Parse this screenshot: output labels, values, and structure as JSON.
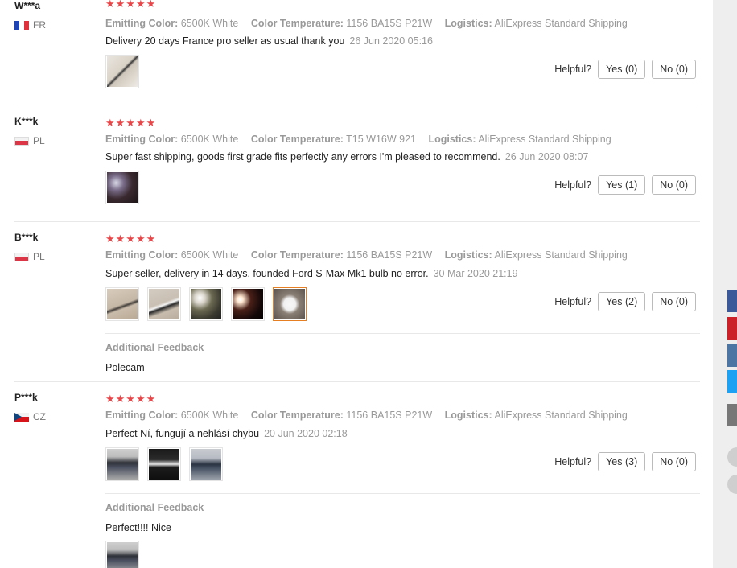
{
  "colors": {
    "star": "#e8474a",
    "accent_border": "#e67e22"
  },
  "helpful_label": "Helpful?",
  "attr_keys": {
    "color": "Emitting Color:",
    "temp": "Color Temperature:",
    "logistics": "Logistics:"
  },
  "additional_feedback_title": "Additional Feedback",
  "reviews": [
    {
      "user": "W***a",
      "country": "FR",
      "stars": "★★★★★",
      "color": "6500K White",
      "temp": "1156 BA15S P21W",
      "logistics": "AliExpress Standard Shipping",
      "text": "Delivery 20 days France pro seller as usual thank you",
      "date": "26 Jun 2020 05:16",
      "yes": "Yes (0)",
      "no": "No (0)"
    },
    {
      "user": "K***k",
      "country": "PL",
      "stars": "★★★★★",
      "color": "6500K White",
      "temp": "T15 W16W 921",
      "logistics": "AliExpress Standard Shipping",
      "text": "Super fast shipping, goods first grade fits perfectly any errors I'm pleased to recommend.",
      "date": "26 Jun 2020 08:07",
      "yes": "Yes (1)",
      "no": "No (0)"
    },
    {
      "user": "B***k",
      "country": "PL",
      "stars": "★★★★★",
      "color": "6500K White",
      "temp": "1156 BA15S P21W",
      "logistics": "AliExpress Standard Shipping",
      "text": "Super seller, delivery in 14 days, founded Ford S-Max Mk1 bulb no error.",
      "date": "30 Mar 2020 21:19",
      "yes": "Yes (2)",
      "no": "No (0)",
      "additional": "Polecam"
    },
    {
      "user": "P***k",
      "country": "CZ",
      "stars": "★★★★★",
      "color": "6500K White",
      "temp": "1156 BA15S P21W",
      "logistics": "AliExpress Standard Shipping",
      "text": "Perfect Ní, fungují a nehlásí chybu",
      "date": "20 Jun 2020 02:18",
      "yes": "Yes (3)",
      "no": "No (0)",
      "additional": "Perfect!!!! Nice"
    }
  ]
}
